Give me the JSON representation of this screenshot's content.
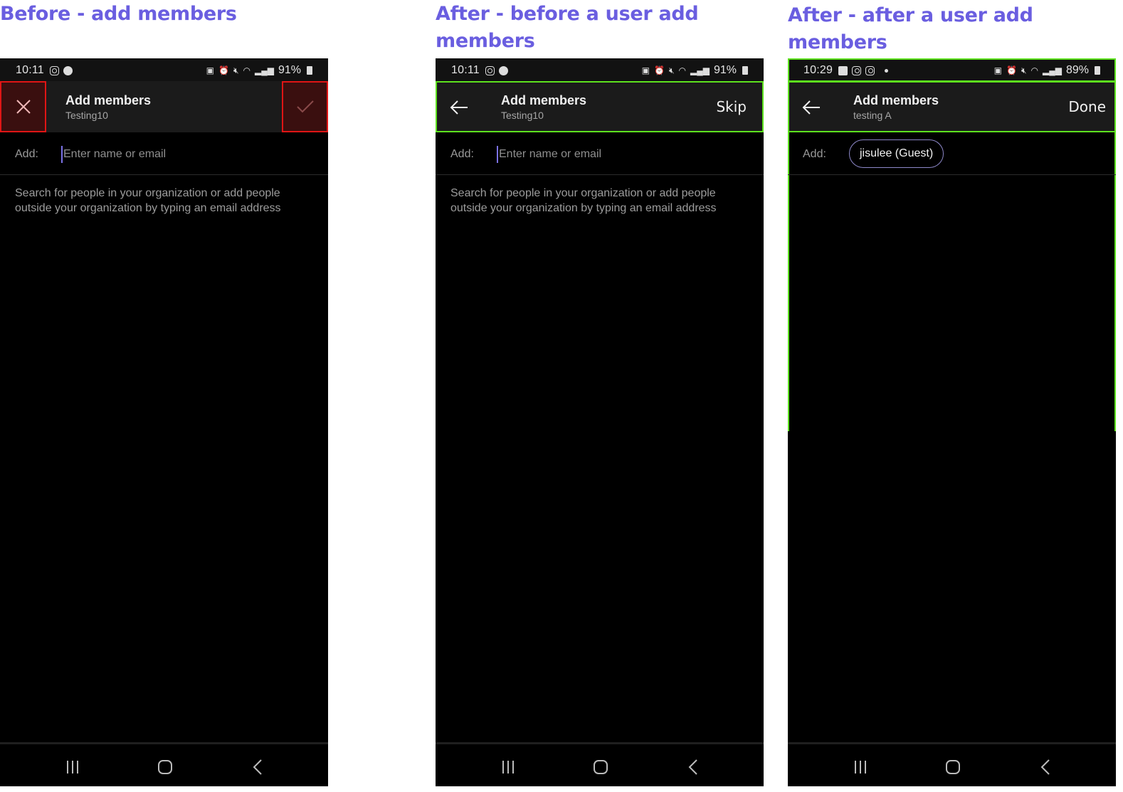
{
  "captions": [
    "Before - add members",
    "After - before a user add members",
    "After - after a user add members"
  ],
  "screens": [
    {
      "status": {
        "time": "10:11",
        "battery": "91%"
      },
      "appbar": {
        "title": "Add members",
        "subtitle": "Testing10",
        "left_action": "close-icon",
        "right_action": "check-icon"
      },
      "add_label": "Add:",
      "input_placeholder": "Enter name or email",
      "hint": "Search for people in your organization or add people outside your organization by typing an email address",
      "highlight_color": "#e01515"
    },
    {
      "status": {
        "time": "10:11",
        "battery": "91%"
      },
      "appbar": {
        "title": "Add members",
        "subtitle": "Testing10",
        "left_action": "back-arrow-icon",
        "right_action_label": "Skip"
      },
      "add_label": "Add:",
      "input_placeholder": "Enter name or email",
      "hint": "Search for people in your organization or add people outside your organization by typing an email address",
      "highlight_color": "#5de21e"
    },
    {
      "status": {
        "time": "10:29",
        "battery": "89%"
      },
      "appbar": {
        "title": "Add members",
        "subtitle": "testing A",
        "left_action": "back-arrow-icon",
        "right_action_label": "Done"
      },
      "add_label": "Add:",
      "chip": "jisulee (Guest)",
      "highlight_color": "#5de21e"
    }
  ],
  "navbar": [
    "recents-icon",
    "home-icon",
    "back-icon"
  ]
}
